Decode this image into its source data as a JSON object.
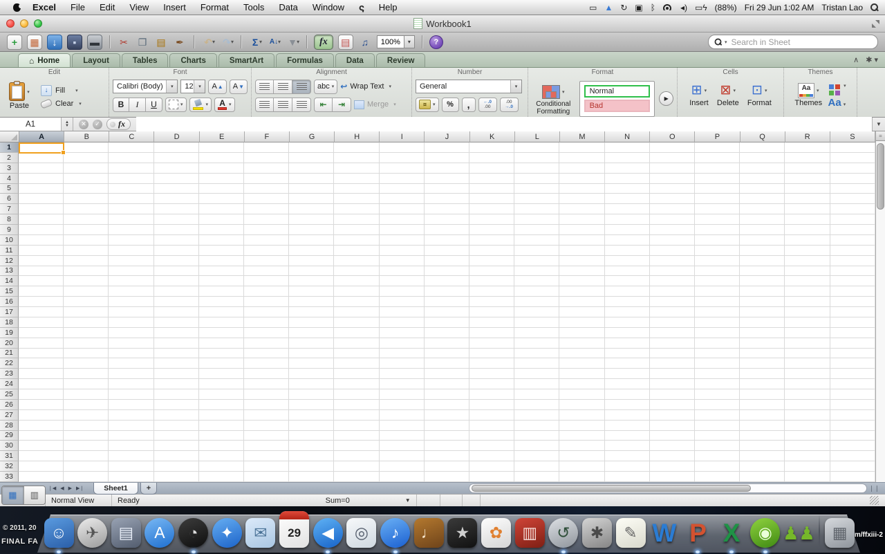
{
  "menu_bar": {
    "items": [
      "Excel",
      "File",
      "Edit",
      "View",
      "Insert",
      "Format",
      "Tools",
      "Data",
      "Window"
    ],
    "script_menu": "script-lightning-icon",
    "help_label": "Help",
    "battery_percent": "(88%)",
    "datetime": "Fri 29 Jun 1:02 AM",
    "user": "Tristan Lao",
    "status_icons": [
      {
        "name": "user-switch-icon",
        "glyph": "▭",
        "color": "#222"
      },
      {
        "name": "airport-menu-icon",
        "glyph": "▲",
        "color": "#3a7bd5"
      },
      {
        "name": "time-machine-menu-icon",
        "glyph": "↻",
        "color": "#222"
      },
      {
        "name": "displays-menu-icon",
        "glyph": "▣",
        "color": "#222"
      },
      {
        "name": "bluetooth-menu-icon",
        "glyph": "ᛒ",
        "color": "#222"
      },
      {
        "name": "wifi-menu-icon",
        "glyph": "",
        "color": "#222",
        "special": "wifi"
      },
      {
        "name": "volume-menu-icon",
        "glyph": "◂)",
        "color": "#222"
      },
      {
        "name": "battery-charging-menu-icon",
        "glyph": "▭ϟ",
        "color": "#222"
      }
    ]
  },
  "window": {
    "title": "Workbook1"
  },
  "toolbar": {
    "zoom": "100%",
    "fx_label": "fx",
    "search_placeholder": "Search in Sheet",
    "items": [
      {
        "t": "icon",
        "name": "new-workbook-icon",
        "g": "+",
        "c": "#2e9e40",
        "bg": "page"
      },
      {
        "t": "icon",
        "name": "templates-gallery-icon",
        "g": "▦",
        "c": "#c06030",
        "bg": "page"
      },
      {
        "t": "icon",
        "name": "open-icon",
        "g": "↓",
        "c": "#ffffff",
        "bg": "blue"
      },
      {
        "t": "icon",
        "name": "save-icon",
        "g": "▪",
        "c": "#c7d3e8",
        "bg": "navy"
      },
      {
        "t": "icon",
        "name": "print-icon",
        "g": "▬",
        "c": "#30353b",
        "bg": "gray"
      },
      {
        "t": "sep"
      },
      {
        "t": "icon",
        "name": "cut-icon",
        "g": "✂",
        "c": "#b03a2e"
      },
      {
        "t": "icon",
        "name": "copy-icon",
        "g": "❐",
        "c": "#5a6b7a"
      },
      {
        "t": "icon",
        "name": "paste-toolbar-icon",
        "g": "▤",
        "c": "#a8720a"
      },
      {
        "t": "icon",
        "name": "format-painter-icon",
        "g": "✒",
        "c": "#7a4a1f"
      },
      {
        "t": "sep"
      },
      {
        "t": "icon",
        "name": "undo-icon",
        "g": "↶",
        "c": "#c9b38c",
        "dd": true
      },
      {
        "t": "icon",
        "name": "redo-icon",
        "g": "↷",
        "c": "#a9bccf",
        "dd": true
      },
      {
        "t": "sep"
      },
      {
        "t": "icon",
        "name": "autosum-icon",
        "g": "Σ",
        "c": "#1a4f9c",
        "dd": true
      },
      {
        "t": "icon",
        "name": "sort-az-icon",
        "g": "A↓",
        "c": "#1a4f9c",
        "dd": true
      },
      {
        "t": "icon",
        "name": "filter-icon",
        "g": "▼",
        "c": "#8a8f96",
        "dd": true
      },
      {
        "t": "sep"
      },
      {
        "t": "fx",
        "name": "formula-builder-button"
      },
      {
        "t": "icon",
        "name": "toolbox-icon",
        "g": "▤",
        "c": "#c0504d",
        "bg": "page"
      },
      {
        "t": "icon",
        "name": "media-browser-icon",
        "g": "♫",
        "c": "#2a4f8f"
      },
      {
        "t": "zoom",
        "name": "zoom-control"
      },
      {
        "t": "sep"
      },
      {
        "t": "help",
        "name": "help-button",
        "g": "?"
      }
    ]
  },
  "ribbon_tabs": {
    "active": "Home",
    "tabs": [
      "Home",
      "Layout",
      "Tables",
      "Charts",
      "SmartArt",
      "Formulas",
      "Data",
      "Review"
    ]
  },
  "ribbon": {
    "groups": {
      "edit": {
        "label": "Edit",
        "paste": "Paste",
        "fill": "Fill",
        "clear": "Clear"
      },
      "font": {
        "label": "Font",
        "family": "Calibri (Body)",
        "size": "12",
        "bold": "B",
        "italic": "I",
        "underline": "U"
      },
      "alignment": {
        "label": "Alignment",
        "abc": "abc",
        "wrap": "Wrap Text",
        "merge": "Merge"
      },
      "number": {
        "label": "Number",
        "format": "General",
        "currency": "¤",
        "percent": "%",
        "comma": ",",
        "inc_dec_top": "←.0",
        "inc_dec_bottom": ".00",
        "dec_dec_top": ".00",
        "dec_dec_bottom": "→.0"
      },
      "format": {
        "label": "Format",
        "conditional_line1": "Conditional",
        "conditional_line2": "Formatting",
        "styles": [
          {
            "name": "Normal",
            "bg": "#ffffff",
            "border": "#2fbf4a",
            "color": "#222222"
          },
          {
            "name": "Bad",
            "bg": "#f4c2c8",
            "border": "#eab6bd",
            "color": "#b5342e"
          }
        ]
      },
      "cells": {
        "label": "Cells",
        "insert": "Insert",
        "delete": "Delete",
        "format": "Format"
      },
      "themes": {
        "label": "Themes",
        "themes": "Themes",
        "fonts": "Aa"
      }
    }
  },
  "formula_bar": {
    "cell_ref": "A1",
    "fx": "fx",
    "value": ""
  },
  "grid": {
    "columns": [
      "A",
      "B",
      "C",
      "D",
      "E",
      "F",
      "G",
      "H",
      "I",
      "J",
      "K",
      "L",
      "M",
      "N",
      "O",
      "P",
      "Q",
      "R",
      "S"
    ],
    "row_count": 33,
    "selected_cell": "A1",
    "selected_column": "A",
    "selected_row": 1
  },
  "sheet_tabs": {
    "tabs": [
      "Sheet1"
    ],
    "add_label": "+"
  },
  "status_bar": {
    "view": "Normal View",
    "state": "Ready",
    "sum": "Sum=0"
  },
  "desktop": {
    "copyright_line1": "© 2011, 20",
    "copyright_line2": "FINAL FA",
    "right_text": "m/ffxiii-2"
  },
  "dock": {
    "icons": [
      {
        "n": "finder",
        "g": "☺",
        "shape": "rsq",
        "b1": "#5a9be0",
        "b2": "#2a5ea8",
        "fg": "#ffffff",
        "run": true
      },
      {
        "n": "launchpad",
        "g": "✈",
        "shape": "circle",
        "b1": "#ececec",
        "b2": "#9b9b9b",
        "fg": "#555555"
      },
      {
        "n": "mission-control",
        "g": "▤",
        "shape": "rsq",
        "b1": "#98a2b3",
        "b2": "#525c6e",
        "fg": "#e8eef8"
      },
      {
        "n": "app-store",
        "g": "A",
        "shape": "circle",
        "b1": "#79b8f4",
        "b2": "#1e6fd0",
        "fg": "#ffffff"
      },
      {
        "n": "dashboard",
        "g": "◔",
        "shape": "circle",
        "b1": "#3c3c3c",
        "b2": "#0e0e0e",
        "fg": "#dddddd",
        "run": true
      },
      {
        "n": "safari",
        "g": "✦",
        "shape": "circle",
        "b1": "#66aef2",
        "b2": "#1c63c9",
        "fg": "#ffffff"
      },
      {
        "n": "mail",
        "g": "✉",
        "shape": "rsq",
        "b1": "#dceafa",
        "b2": "#a9c6e2",
        "fg": "#4a7296"
      },
      {
        "n": "ical",
        "g": "29",
        "shape": "cal",
        "b1": "#ffffff",
        "b2": "#e2e2e2",
        "fg": "#222222"
      },
      {
        "n": "facetime",
        "g": "◀",
        "shape": "circle",
        "b1": "#5fb2f5",
        "b2": "#1763c8",
        "fg": "#ffffff",
        "run": true
      },
      {
        "n": "preview",
        "g": "◎",
        "shape": "rsq",
        "b1": "#f7f9fb",
        "b2": "#cfd8e0",
        "fg": "#57606e"
      },
      {
        "n": "itunes",
        "g": "♪",
        "shape": "circle",
        "b1": "#6ab0f5",
        "b2": "#1a5fd0",
        "fg": "#ffffff",
        "run": true
      },
      {
        "n": "garageband",
        "g": "♩",
        "shape": "rsq",
        "b1": "#b4792f",
        "b2": "#6e431a",
        "fg": "#f5e3c8"
      },
      {
        "n": "imovie",
        "g": "★",
        "shape": "rsq",
        "b1": "#3a3a3a",
        "b2": "#111111",
        "fg": "#cfcfcf"
      },
      {
        "n": "iphoto",
        "g": "✿",
        "shape": "rsq",
        "b1": "#fdfdfd",
        "b2": "#d5d5d5",
        "fg": "#e08030"
      },
      {
        "n": "photo-booth",
        "g": "▥",
        "shape": "rsq",
        "b1": "#d04437",
        "b2": "#7e1f14",
        "fg": "#f7ded9"
      },
      {
        "n": "time-machine",
        "g": "↺",
        "shape": "circle",
        "b1": "#dde0e4",
        "b2": "#8f959c",
        "fg": "#2e4e39",
        "run": true
      },
      {
        "n": "system-preferences",
        "g": "✱",
        "shape": "rsq",
        "b1": "#d4d4d4",
        "b2": "#858585",
        "fg": "#4a4a4a"
      },
      {
        "n": "textedit",
        "g": "✎",
        "shape": "rsq",
        "b1": "#fdfdf6",
        "b2": "#d9d9cc",
        "fg": "#666666"
      },
      {
        "n": "word",
        "g": "W",
        "shape": "plain",
        "fg": "#2b7cd3"
      },
      {
        "n": "powerpoint",
        "g": "P",
        "shape": "plain",
        "fg": "#d35230",
        "run": true
      },
      {
        "n": "excel",
        "g": "X",
        "shape": "plain",
        "fg": "#1f9246",
        "run": true
      },
      {
        "n": "communicator",
        "g": "◉",
        "shape": "circle",
        "b1": "#8fd23f",
        "b2": "#3f8912",
        "fg": "#eaffda",
        "run": true
      },
      {
        "n": "messenger-buddies",
        "g": "♟♟",
        "shape": "plain",
        "fg": "#76b82a"
      },
      {
        "t": "sep"
      },
      {
        "n": "trash",
        "g": "▦",
        "shape": "rsq",
        "b1": "#d6d9dd",
        "b2": "#8e949b",
        "fg": "#5f646b"
      }
    ]
  },
  "colors": {
    "selection": "#F0A01E",
    "excel_green": "#1f9246",
    "ribbon_tab_green": "#c9d5c9"
  }
}
